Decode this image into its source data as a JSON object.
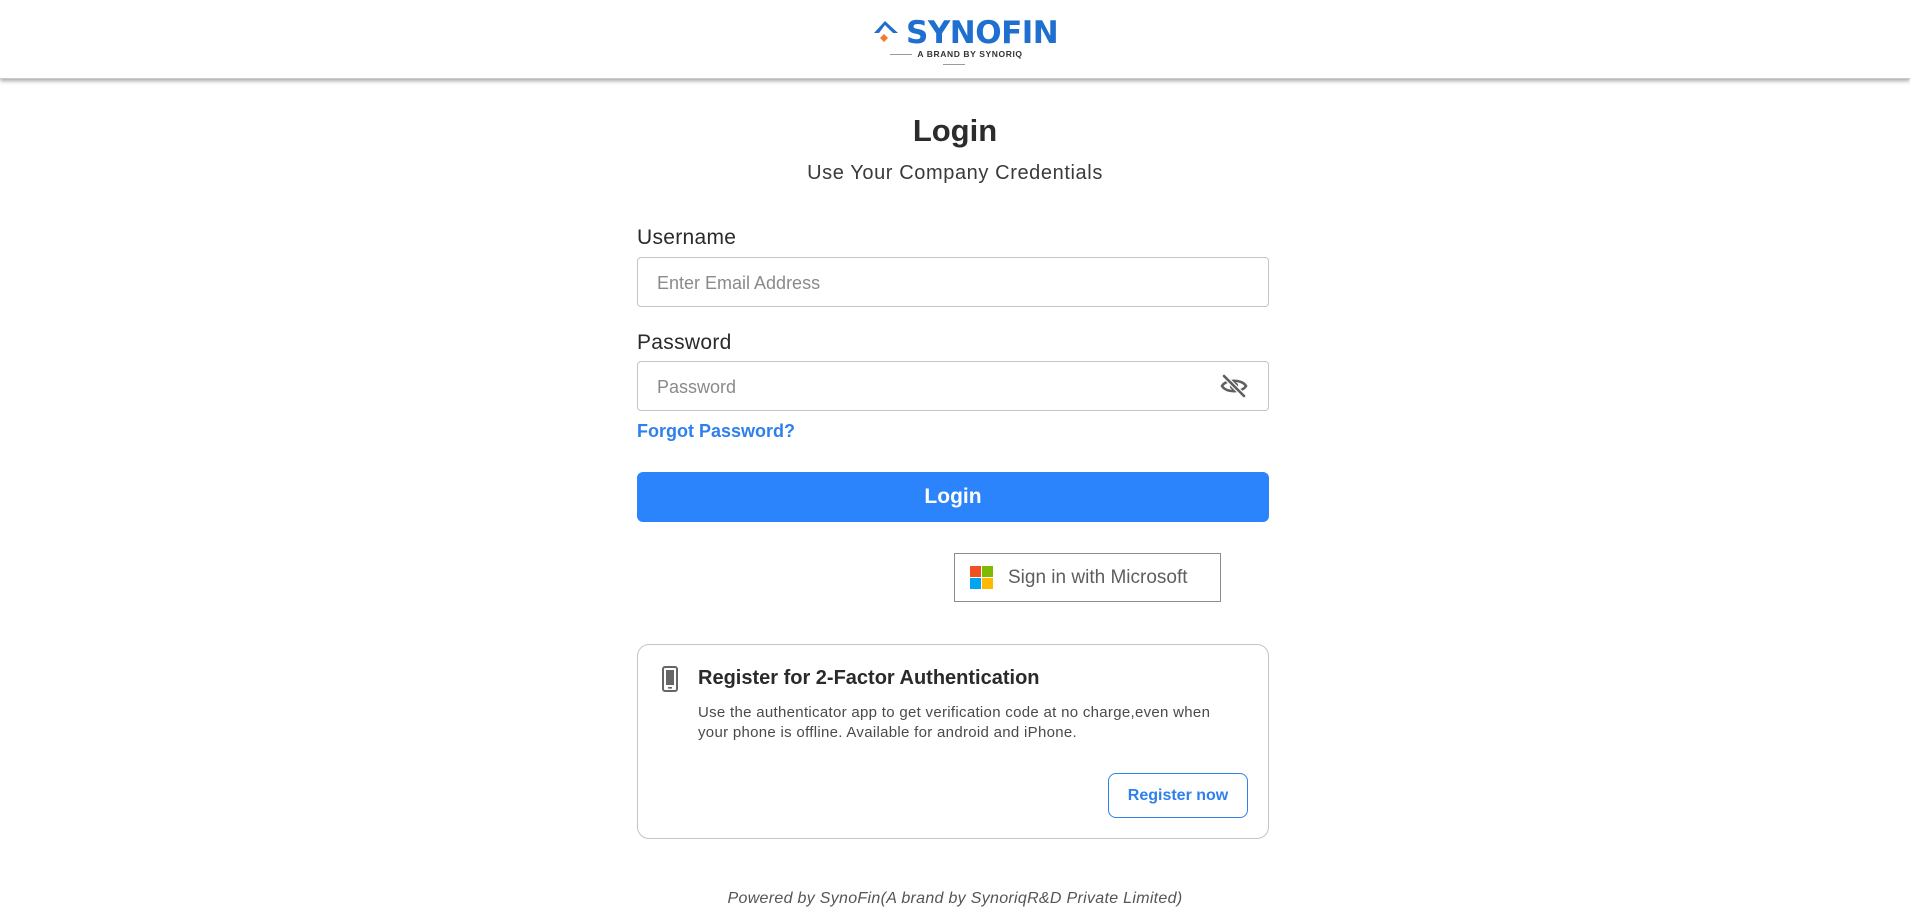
{
  "header": {
    "brand_name": "SYNOFIN",
    "brand_tagline": "A BRAND BY SYNORIQ",
    "brand_color": "#1f6fd0",
    "accent_color": "#f07b2b"
  },
  "login": {
    "title": "Login",
    "subtitle": "Use Your Company Credentials",
    "username_label": "Username",
    "username_placeholder": "Enter Email Address",
    "username_value": "",
    "password_label": "Password",
    "password_placeholder": "Password",
    "password_value": "",
    "password_toggle_icon": "eye-off-icon",
    "forgot_password_label": "Forgot Password?",
    "login_button_label": "Login",
    "primary_color": "#2b84fb"
  },
  "microsoft": {
    "label": "Sign in with Microsoft",
    "icon": "microsoft-logo-icon",
    "logo_colors": [
      "#f25022",
      "#7fba00",
      "#00a4ef",
      "#ffb900"
    ]
  },
  "two_factor": {
    "icon": "mobile-phone-icon",
    "title": "Register for 2-Factor Authentication",
    "description": "Use the authenticator app to get verification code at no charge,even when your phone is offline. Available for android and iPhone.",
    "register_button_label": "Register now"
  },
  "footer": {
    "text": "Powered by SynoFin(A brand by SynoriqR&D Private Limited)"
  }
}
